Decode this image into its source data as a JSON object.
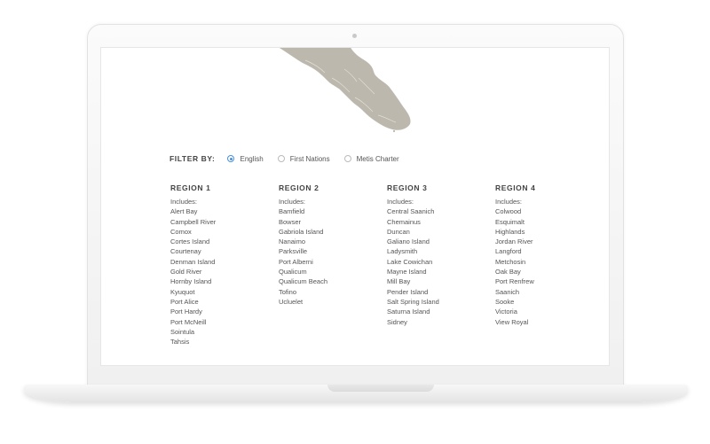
{
  "filter": {
    "label": "FILTER BY:",
    "options": [
      {
        "label": "English",
        "selected": true
      },
      {
        "label": "First Nations",
        "selected": false
      },
      {
        "label": "Metis Charter",
        "selected": false
      }
    ]
  },
  "regions": [
    {
      "title": "REGION 1",
      "includes_label": "Includes:",
      "items": [
        "Alert Bay",
        "Campbell River",
        "Comox",
        "Cortes Island",
        "Courtenay",
        "Denman Island",
        "Gold River",
        "Hornby Island",
        "Kyuquot",
        "Port Alice",
        "Port Hardy",
        "Port McNeill",
        "Sointula",
        "Tahsis"
      ]
    },
    {
      "title": "REGION 2",
      "includes_label": "Includes:",
      "items": [
        "Bamfield",
        "Bowser",
        "Gabriola Island",
        "Nanaimo",
        "Parksville",
        "Port Alberni",
        "Qualicum",
        "Qualicum Beach",
        "Tofino",
        "Ucluelet"
      ]
    },
    {
      "title": "REGION 3",
      "includes_label": "Includes:",
      "items": [
        "Central Saanich",
        "Chemainus",
        "Duncan",
        "Galiano Island",
        "Ladysmith",
        "Lake Cowichan",
        "Mayne Island",
        "Mill Bay",
        "Pender Island",
        "Salt Spring Island",
        "Saturna Island",
        "Sidney"
      ]
    },
    {
      "title": "REGION 4",
      "includes_label": "Includes:",
      "items": [
        "Colwood",
        "Esquimalt",
        "Highlands",
        "Jordan River",
        "Langford",
        "Metchosin",
        "Oak Bay",
        "Port Renfrew",
        "Saanich",
        "Sooke",
        "Victoria",
        "View Royal"
      ]
    }
  ],
  "colors": {
    "map_fill": "#bdb8ad",
    "radio_accent": "#4a90d9",
    "text": "#555555"
  }
}
